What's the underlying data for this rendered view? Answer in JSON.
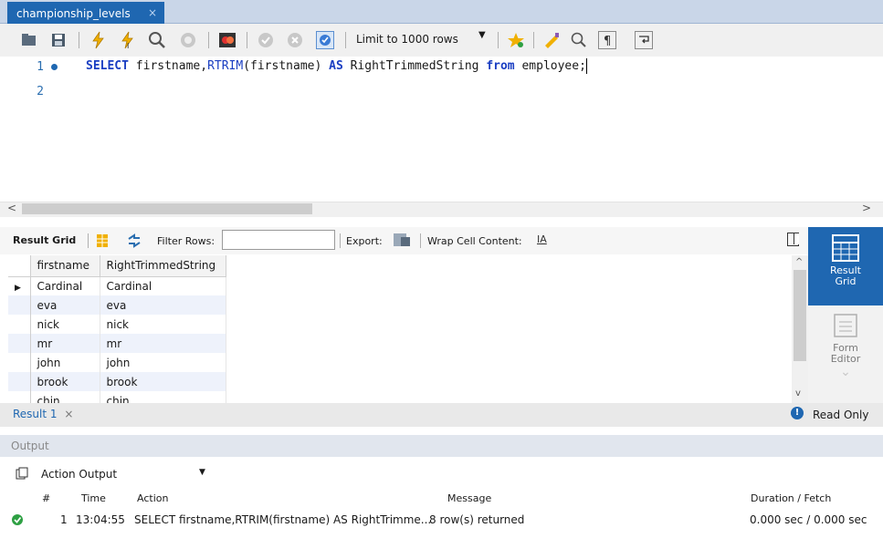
{
  "tab": {
    "title": "championship_levels",
    "close": "×"
  },
  "toolbar": {
    "limit_label": "Limit to 1000 rows",
    "icons": [
      "folder-icon",
      "save-icon",
      "execute-icon",
      "execute-current-icon",
      "explain-icon",
      "stop-icon",
      "toggle-icon",
      "commit-icon",
      "rollback-icon",
      "autocommit-icon",
      "bookmark-icon",
      "beautify-icon",
      "find-icon",
      "invisible-chars-icon",
      "wrap-icon"
    ]
  },
  "editor": {
    "lines": [
      "1",
      "2"
    ],
    "sql": {
      "k1": "SELECT",
      "p1": " firstname,",
      "f1": "RTRIM",
      "p2": "(firstname) ",
      "k2": "AS",
      "p3": " RightTrimmedString ",
      "k3": "from",
      "p4": " employee;"
    }
  },
  "result_toolbar": {
    "result_grid": "Result Grid",
    "filter_rows": "Filter Rows:",
    "export": "Export:",
    "wrap_cell": "Wrap Cell Content:"
  },
  "grid": {
    "columns": [
      "firstname",
      "RightTrimmedString"
    ],
    "rows": [
      [
        "Cardinal",
        "Cardinal"
      ],
      [
        "eva",
        "eva"
      ],
      [
        "nick",
        "nick"
      ],
      [
        "mr",
        "mr"
      ],
      [
        "john",
        "john"
      ],
      [
        "brook",
        "brook"
      ],
      [
        "chin",
        "chin"
      ]
    ]
  },
  "side_panel": {
    "result_grid": "Result\nGrid",
    "form_editor": "Form\nEditor"
  },
  "result_tab": {
    "label": "Result 1",
    "close": "×",
    "read_only": "Read Only"
  },
  "output": {
    "header": "Output",
    "selector": "Action Output",
    "columns": {
      "num": "#",
      "time": "Time",
      "action": "Action",
      "message": "Message",
      "duration": "Duration / Fetch"
    },
    "row": {
      "num": "1",
      "time": "13:04:55",
      "action": "SELECT firstname,RTRIM(firstname) AS RightTrimme...",
      "message": "8 row(s) returned",
      "duration": "0.000 sec / 0.000 sec"
    }
  },
  "colors": {
    "accent": "#1f67b1",
    "keyword": "#1a3ec2",
    "success": "#2ea043"
  }
}
